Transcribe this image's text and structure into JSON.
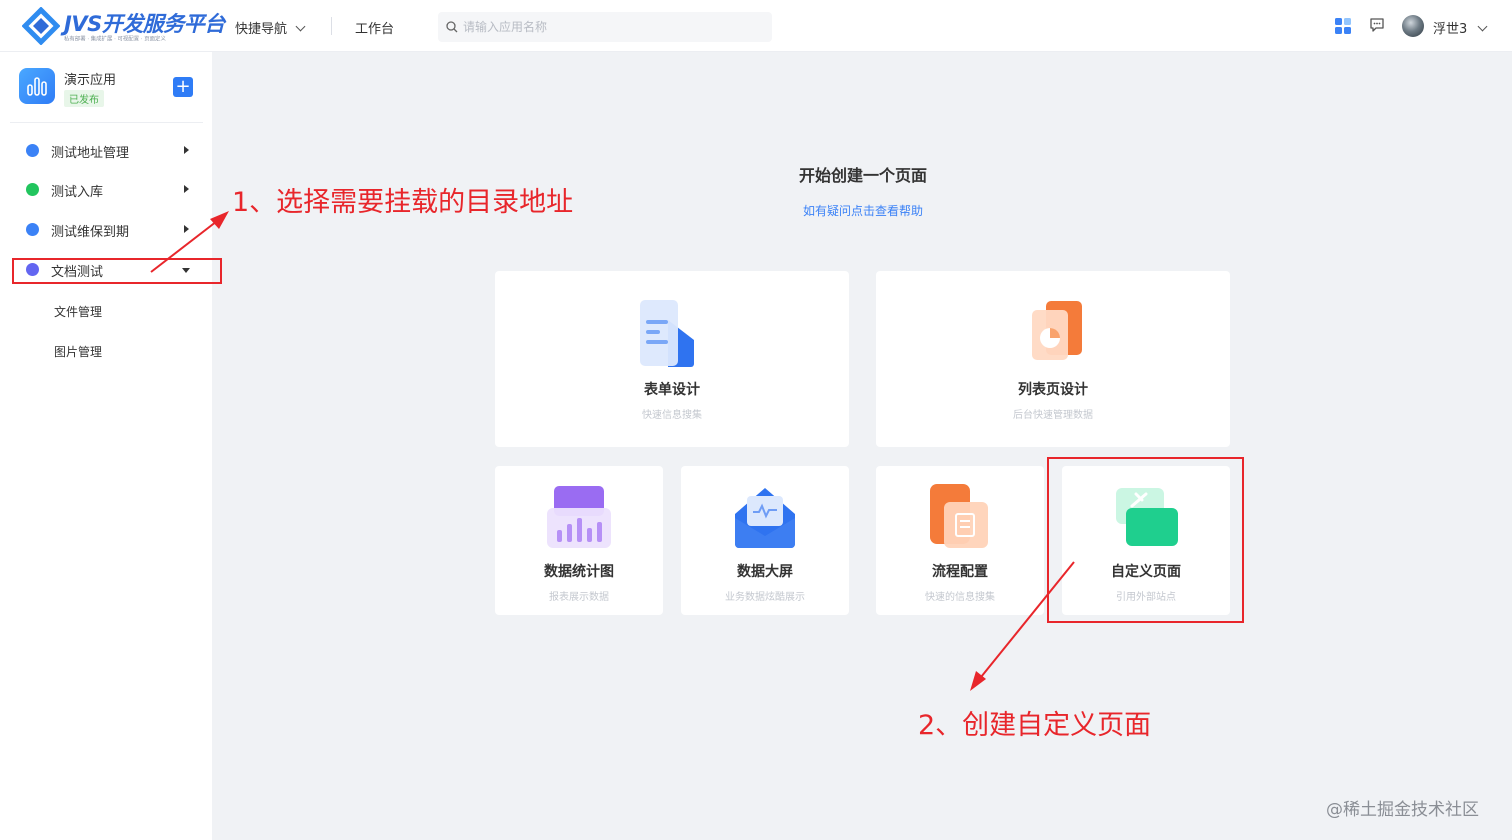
{
  "header": {
    "logo_title": "JVS开发服务平台",
    "logo_slogan": "私有部署 · 集成扩展 · 可视配置 · 页面定义",
    "nav_quick": "快捷导航",
    "nav_workbench": "工作台",
    "search_placeholder": "请输入应用名称",
    "user_name": "浮世3",
    "icons": [
      "app-grid-icon",
      "chat-icon",
      "avatar"
    ]
  },
  "sidebar": {
    "app_name": "演示应用",
    "app_status": "已发布",
    "menu": [
      {
        "label": "测试地址管理",
        "icon_color": "#3b82f6",
        "expanded": false
      },
      {
        "label": "测试入库",
        "icon_color": "#22c55e",
        "expanded": false
      },
      {
        "label": "测试维保到期",
        "icon_color": "#3b82f6",
        "expanded": false
      },
      {
        "label": "文档测试",
        "icon_color": "#6366f1",
        "expanded": true
      }
    ],
    "submenu": [
      "文件管理",
      "图片管理"
    ]
  },
  "main": {
    "title": "开始创建一个页面",
    "help_link": "如有疑问点击查看帮助",
    "cards": [
      {
        "title": "表单设计",
        "desc": "快速信息搜集",
        "icon": "form-design-icon"
      },
      {
        "title": "列表页设计",
        "desc": "后台快速管理数据",
        "icon": "list-design-icon"
      },
      {
        "title": "数据统计图",
        "desc": "报表展示数据",
        "icon": "chart-icon"
      },
      {
        "title": "数据大屏",
        "desc": "业务数据炫酷展示",
        "icon": "dashboard-icon"
      },
      {
        "title": "流程配置",
        "desc": "快速的信息搜集",
        "icon": "workflow-icon"
      },
      {
        "title": "自定义页面",
        "desc": "引用外部站点",
        "icon": "custom-page-icon"
      }
    ]
  },
  "annotations": {
    "step1": "1、选择需要挂载的目录地址",
    "step2": "2、创建自定义页面",
    "color": "#e8262b"
  },
  "watermark": "@稀土掘金技术社区"
}
